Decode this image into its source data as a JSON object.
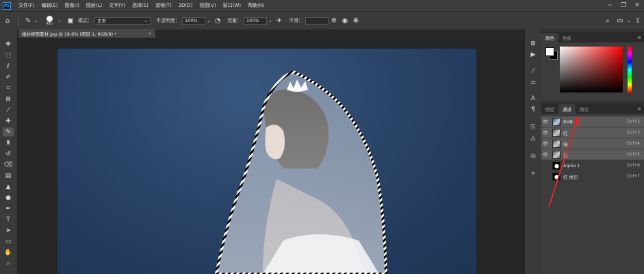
{
  "app": {
    "logo": "Ps"
  },
  "menu": [
    "文件(F)",
    "编辑(E)",
    "图像(I)",
    "图层(L)",
    "文字(Y)",
    "选择(S)",
    "滤镜(T)",
    "3D(D)",
    "视图(V)",
    "窗口(W)",
    "帮助(H)"
  ],
  "window_controls": [
    "−",
    "❐",
    "✕"
  ],
  "options": {
    "brush_size": "480",
    "mode_label": "模式：",
    "mode_value": "正常",
    "opacity_label": "不透明度：",
    "opacity_value": "100%",
    "flow_label": "流量：",
    "flow_value": "100%",
    "smooth_label": "平滑：",
    "smooth_value": ""
  },
  "document": {
    "tab_title": "婚纱抠图素材.jpg @ 18.6% (图层 1, RGB/8) *",
    "close": "×"
  },
  "panels": {
    "top_tabs": [
      "颜色",
      "色板"
    ],
    "mid_tabs": [
      "图层",
      "通道",
      "路径"
    ],
    "menu_icon": "≡",
    "channels": [
      {
        "name": "RGB",
        "shortcut": "Ctrl+2",
        "visible": true,
        "thumb": "rgb"
      },
      {
        "name": "红",
        "shortcut": "Ctrl+3",
        "visible": true,
        "thumb": "gray"
      },
      {
        "name": "绿",
        "shortcut": "Ctrl+4",
        "visible": true,
        "thumb": "gray"
      },
      {
        "name": "蓝",
        "shortcut": "Ctrl+5",
        "visible": true,
        "thumb": "gray"
      },
      {
        "name": "Alpha 1",
        "shortcut": "Ctrl+6",
        "visible": false,
        "thumb": "alpha"
      },
      {
        "name": "红 拷贝",
        "shortcut": "Ctrl+7",
        "visible": false,
        "thumb": "alpha"
      }
    ]
  },
  "colors": {
    "annotation_arrow": "#d9292b",
    "canvas_bg": "#2c466b"
  }
}
